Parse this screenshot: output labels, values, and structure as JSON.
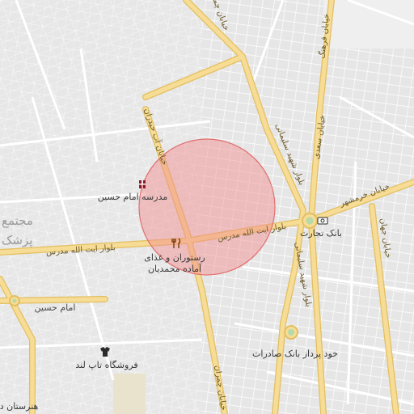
{
  "map": {
    "roads": {
      "ayatollah_modarres": "بلوار ایت الله مدرس",
      "shahid_soleimani": "بلوار شهید سلیمانی",
      "khorramshahr": "خیابان خرمشهر",
      "imam_hossein": "امام حسین",
      "ab_haydari": "خیابان آب حیدران",
      "chamran_east": "خیابان چمران",
      "sadi": "خیابان سعدی",
      "jahan": "خیابان جهان",
      "farhang": "خیابان فرهنگ"
    },
    "pois": {
      "school": "مدرسه امام حسین",
      "restaurant_line1": "رستوران و غذای",
      "restaurant_line2": "آماده محمدیان",
      "bank_tejarat": "بانک تجارت",
      "bank_saderat": "خود پرداز بانک صادرات",
      "shop": "فروشگاه تاپ لند",
      "school_bottom": "هنرستان دخ"
    },
    "faint_labels": {
      "left_top": "مجتمع",
      "left_bottom": "پزشک"
    },
    "icons": [
      "school-icon",
      "restaurant-icon",
      "bank-icon",
      "shop-icon",
      "roundabout-icon"
    ],
    "colors": {
      "background": "#ededed",
      "street": "#ffffff",
      "major_road": "#f3d58a",
      "major_road_casing": "#e2bf62",
      "highlight_fill": "#f28b8b",
      "highlight_stroke": "#e07070"
    }
  }
}
